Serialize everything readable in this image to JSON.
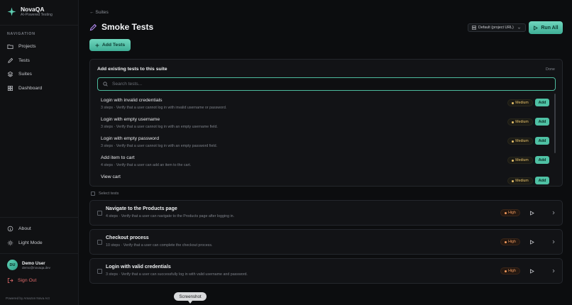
{
  "brand": {
    "name": "NovaQA",
    "tagline": "AI-Powered Testing",
    "icon": "sparkle-icon",
    "accent": "#4fc1a4"
  },
  "sidebar": {
    "heading": "NAVIGATION",
    "items": [
      {
        "label": "Projects",
        "icon": "folder-icon"
      },
      {
        "label": "Tests",
        "icon": "pencil-icon"
      },
      {
        "label": "Suites",
        "icon": "layers-icon"
      },
      {
        "label": "Dashboard",
        "icon": "grid-icon"
      }
    ],
    "bottom_items": [
      {
        "label": "About",
        "icon": "info-icon"
      },
      {
        "label": "Light Mode",
        "icon": "sun-icon"
      }
    ],
    "user": {
      "initials": "DU",
      "name": "Demo User",
      "email": "demo@novaqa.dev"
    },
    "sign_out": "Sign Out",
    "powered_by": "Powered by Amazon Nova Act"
  },
  "header": {
    "back_label": "← Suites",
    "title": "Smoke Tests",
    "environment": "Default (project URL)",
    "run_all": "Run All",
    "add_tests": "Add Tests"
  },
  "add_panel": {
    "title": "Add existing tests to this suite",
    "done": "Done",
    "search_placeholder": "Search tests...",
    "add_label": "Add",
    "items": [
      {
        "name": "Login with invalid credentials",
        "meta": "3 steps · Verify that a user cannot log in with invalid username or password.",
        "priority": "Medium"
      },
      {
        "name": "Login with empty username",
        "meta": "3 steps · Verify that a user cannot log in with an empty username field.",
        "priority": "Medium"
      },
      {
        "name": "Login with empty password",
        "meta": "3 steps · Verify that a user cannot log in with an empty password field.",
        "priority": "Medium"
      },
      {
        "name": "Add item to cart",
        "meta": "4 steps · Verify that a user can add an item to the cart.",
        "priority": "Medium"
      },
      {
        "name": "View cart",
        "meta": "",
        "priority": "Medium"
      }
    ]
  },
  "select_tests": "Select tests",
  "cases": [
    {
      "name": "Navigate to the Products page",
      "meta": "4 steps · Verify that a user can navigate to the Products page after logging in.",
      "priority": "High"
    },
    {
      "name": "Checkout process",
      "meta": "10 steps · Verify that a user can complete the checkout process.",
      "priority": "High"
    },
    {
      "name": "Login with valid credentials",
      "meta": "3 steps · Verify that a user can successfully log in with valid username and password.",
      "priority": "High"
    }
  ],
  "tooltip": "Screenshot"
}
